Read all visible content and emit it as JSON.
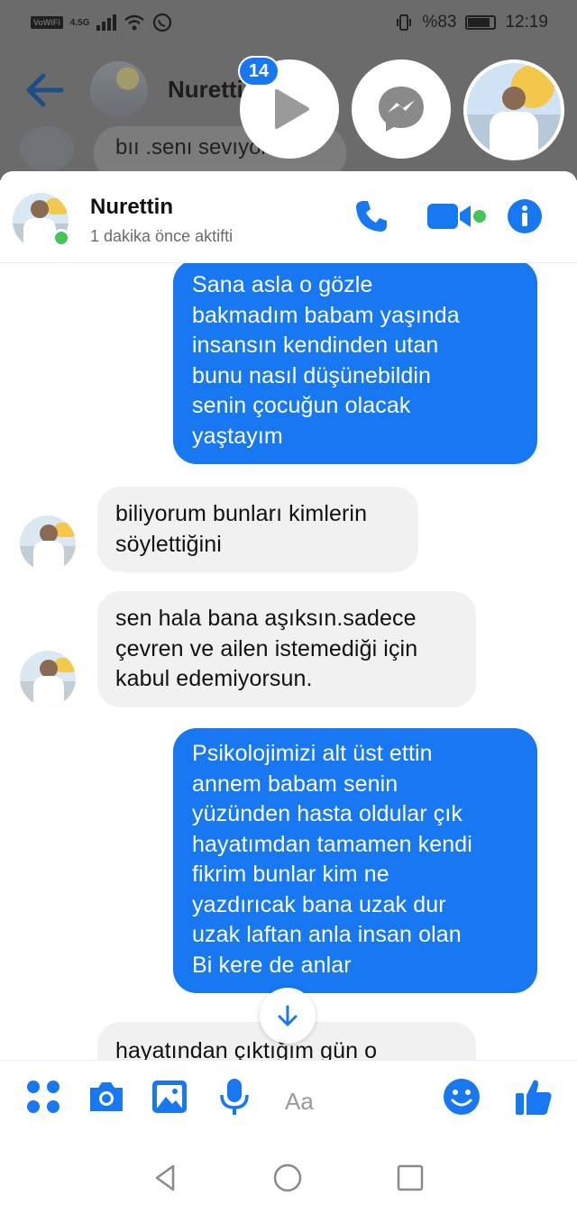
{
  "status_bar": {
    "vowifi": "VoWiFi",
    "network": "4.5G",
    "battery_text": "%83",
    "time": "12:19"
  },
  "background": {
    "contact_name": "Nurettin",
    "partial_message": "bıı .senı sevıyorum."
  },
  "chat_heads": {
    "badge_count": "14"
  },
  "conversation": {
    "contact_name": "Nurettin",
    "status": "1 dakika önce aktifti",
    "messages": [
      {
        "side": "out",
        "text": "Sana asla o gözle\nbakmadım babam yaşında\ninsansın kendinden utan\nbunu nasıl düşünebildin\nsenin çocuğun olacak\nyaştayım"
      },
      {
        "side": "in",
        "text": "biliyorum bunları kimlerin\nsöylettiğini"
      },
      {
        "side": "in",
        "text": "sen hala bana aşıksın.sadece\nçevren ve ailen istemediği için\nkabul edemiyorsun."
      },
      {
        "side": "out",
        "text": "Psikolojimizi alt üst ettin\nannem babam senin\nyüzünden hasta oldular çık\nhayatımdan tamamen kendi\nfikrim bunlar kim ne\nyazdırıcak bana uzak dur\nuzak laftan anla insan olan\nBi kere de anlar"
      },
      {
        "side": "in",
        "text": "hayatından çıktığım gün o"
      }
    ]
  },
  "composer": {
    "placeholder": "Aa",
    "accent": "#1778f2"
  },
  "icons": [
    "back-arrow-icon",
    "play-icon",
    "messenger-icon",
    "phone-icon",
    "video-icon",
    "info-icon",
    "apps-icon",
    "camera-icon",
    "gallery-icon",
    "mic-icon",
    "emoji-icon",
    "thumbs-up-icon",
    "arrow-down-icon",
    "nav-back-icon",
    "nav-home-icon",
    "nav-recents-icon"
  ]
}
